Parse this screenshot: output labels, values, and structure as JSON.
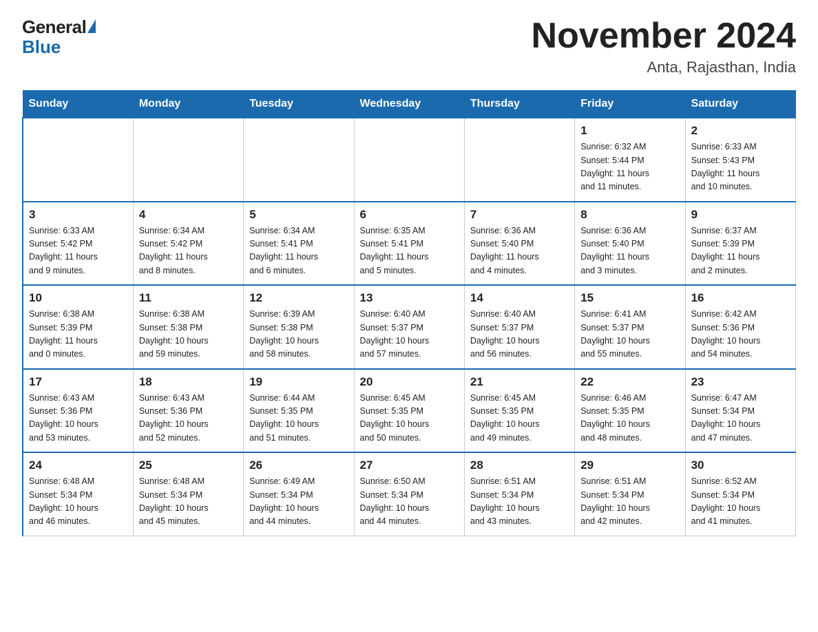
{
  "logo": {
    "general": "General",
    "blue": "Blue"
  },
  "title": {
    "month": "November 2024",
    "location": "Anta, Rajasthan, India"
  },
  "weekdays": [
    "Sunday",
    "Monday",
    "Tuesday",
    "Wednesday",
    "Thursday",
    "Friday",
    "Saturday"
  ],
  "weeks": [
    [
      {
        "day": "",
        "info": ""
      },
      {
        "day": "",
        "info": ""
      },
      {
        "day": "",
        "info": ""
      },
      {
        "day": "",
        "info": ""
      },
      {
        "day": "",
        "info": ""
      },
      {
        "day": "1",
        "info": "Sunrise: 6:32 AM\nSunset: 5:44 PM\nDaylight: 11 hours\nand 11 minutes."
      },
      {
        "day": "2",
        "info": "Sunrise: 6:33 AM\nSunset: 5:43 PM\nDaylight: 11 hours\nand 10 minutes."
      }
    ],
    [
      {
        "day": "3",
        "info": "Sunrise: 6:33 AM\nSunset: 5:42 PM\nDaylight: 11 hours\nand 9 minutes."
      },
      {
        "day": "4",
        "info": "Sunrise: 6:34 AM\nSunset: 5:42 PM\nDaylight: 11 hours\nand 8 minutes."
      },
      {
        "day": "5",
        "info": "Sunrise: 6:34 AM\nSunset: 5:41 PM\nDaylight: 11 hours\nand 6 minutes."
      },
      {
        "day": "6",
        "info": "Sunrise: 6:35 AM\nSunset: 5:41 PM\nDaylight: 11 hours\nand 5 minutes."
      },
      {
        "day": "7",
        "info": "Sunrise: 6:36 AM\nSunset: 5:40 PM\nDaylight: 11 hours\nand 4 minutes."
      },
      {
        "day": "8",
        "info": "Sunrise: 6:36 AM\nSunset: 5:40 PM\nDaylight: 11 hours\nand 3 minutes."
      },
      {
        "day": "9",
        "info": "Sunrise: 6:37 AM\nSunset: 5:39 PM\nDaylight: 11 hours\nand 2 minutes."
      }
    ],
    [
      {
        "day": "10",
        "info": "Sunrise: 6:38 AM\nSunset: 5:39 PM\nDaylight: 11 hours\nand 0 minutes."
      },
      {
        "day": "11",
        "info": "Sunrise: 6:38 AM\nSunset: 5:38 PM\nDaylight: 10 hours\nand 59 minutes."
      },
      {
        "day": "12",
        "info": "Sunrise: 6:39 AM\nSunset: 5:38 PM\nDaylight: 10 hours\nand 58 minutes."
      },
      {
        "day": "13",
        "info": "Sunrise: 6:40 AM\nSunset: 5:37 PM\nDaylight: 10 hours\nand 57 minutes."
      },
      {
        "day": "14",
        "info": "Sunrise: 6:40 AM\nSunset: 5:37 PM\nDaylight: 10 hours\nand 56 minutes."
      },
      {
        "day": "15",
        "info": "Sunrise: 6:41 AM\nSunset: 5:37 PM\nDaylight: 10 hours\nand 55 minutes."
      },
      {
        "day": "16",
        "info": "Sunrise: 6:42 AM\nSunset: 5:36 PM\nDaylight: 10 hours\nand 54 minutes."
      }
    ],
    [
      {
        "day": "17",
        "info": "Sunrise: 6:43 AM\nSunset: 5:36 PM\nDaylight: 10 hours\nand 53 minutes."
      },
      {
        "day": "18",
        "info": "Sunrise: 6:43 AM\nSunset: 5:36 PM\nDaylight: 10 hours\nand 52 minutes."
      },
      {
        "day": "19",
        "info": "Sunrise: 6:44 AM\nSunset: 5:35 PM\nDaylight: 10 hours\nand 51 minutes."
      },
      {
        "day": "20",
        "info": "Sunrise: 6:45 AM\nSunset: 5:35 PM\nDaylight: 10 hours\nand 50 minutes."
      },
      {
        "day": "21",
        "info": "Sunrise: 6:45 AM\nSunset: 5:35 PM\nDaylight: 10 hours\nand 49 minutes."
      },
      {
        "day": "22",
        "info": "Sunrise: 6:46 AM\nSunset: 5:35 PM\nDaylight: 10 hours\nand 48 minutes."
      },
      {
        "day": "23",
        "info": "Sunrise: 6:47 AM\nSunset: 5:34 PM\nDaylight: 10 hours\nand 47 minutes."
      }
    ],
    [
      {
        "day": "24",
        "info": "Sunrise: 6:48 AM\nSunset: 5:34 PM\nDaylight: 10 hours\nand 46 minutes."
      },
      {
        "day": "25",
        "info": "Sunrise: 6:48 AM\nSunset: 5:34 PM\nDaylight: 10 hours\nand 45 minutes."
      },
      {
        "day": "26",
        "info": "Sunrise: 6:49 AM\nSunset: 5:34 PM\nDaylight: 10 hours\nand 44 minutes."
      },
      {
        "day": "27",
        "info": "Sunrise: 6:50 AM\nSunset: 5:34 PM\nDaylight: 10 hours\nand 44 minutes."
      },
      {
        "day": "28",
        "info": "Sunrise: 6:51 AM\nSunset: 5:34 PM\nDaylight: 10 hours\nand 43 minutes."
      },
      {
        "day": "29",
        "info": "Sunrise: 6:51 AM\nSunset: 5:34 PM\nDaylight: 10 hours\nand 42 minutes."
      },
      {
        "day": "30",
        "info": "Sunrise: 6:52 AM\nSunset: 5:34 PM\nDaylight: 10 hours\nand 41 minutes."
      }
    ]
  ]
}
